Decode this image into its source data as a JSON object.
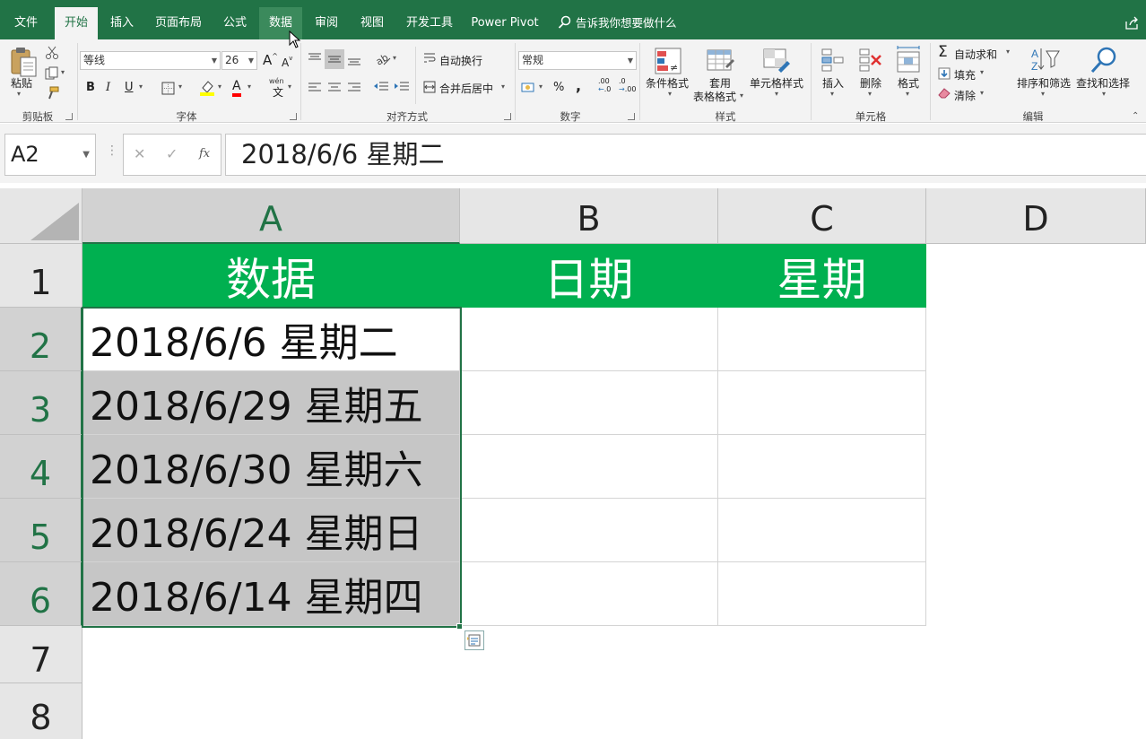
{
  "tabs": {
    "file": "文件",
    "home": "开始",
    "insert": "插入",
    "page_layout": "页面布局",
    "formulas": "公式",
    "data": "数据",
    "review": "审阅",
    "view": "视图",
    "developer": "开发工具",
    "power_pivot": "Power Pivot",
    "tell_me": "告诉我你想要做什么"
  },
  "ribbon": {
    "clipboard": {
      "paste": "粘贴",
      "group": "剪贴板"
    },
    "font": {
      "name": "等线",
      "size": "26",
      "group": "字体",
      "bold": "B",
      "italic": "I",
      "underline": "U",
      "grow": "A",
      "shrink": "A",
      "font_color": "A",
      "phonetic": "wén"
    },
    "alignment": {
      "wrap": "自动换行",
      "merge": "合并后居中",
      "group": "对齐方式"
    },
    "number": {
      "format": "常规",
      "percent": "%",
      "comma": ",",
      "inc_decimal": ".00",
      "dec_decimal": ".0",
      "group": "数字"
    },
    "styles": {
      "conditional": "条件格式",
      "table_line1": "套用",
      "table_line2": "表格格式",
      "cell_styles": "单元格样式",
      "group": "样式"
    },
    "cells": {
      "insert": "插入",
      "delete": "删除",
      "format": "格式",
      "group": "单元格"
    },
    "editing": {
      "autosum": "自动求和",
      "fill": "填充",
      "clear": "清除",
      "sort": "排序和筛选",
      "find": "查找和选择",
      "group": "编辑"
    }
  },
  "formula_bar": {
    "name_box": "A2",
    "fx": "fx",
    "content": "2018/6/6 星期二"
  },
  "sheet": {
    "columns": [
      "A",
      "B",
      "C",
      "D"
    ],
    "rows": [
      "1",
      "2",
      "3",
      "4",
      "5",
      "6",
      "7",
      "8"
    ],
    "headers": [
      "数据",
      "日期",
      "星期"
    ],
    "data": [
      "2018/6/6 星期二",
      "2018/6/29 星期五",
      "2018/6/30 星期六",
      "2018/6/24 星期日",
      "2018/6/14 星期四"
    ]
  },
  "colors": {
    "excel_green": "#217346",
    "header_fill": "#00b050",
    "selection_gray": "#c6c6c6"
  }
}
